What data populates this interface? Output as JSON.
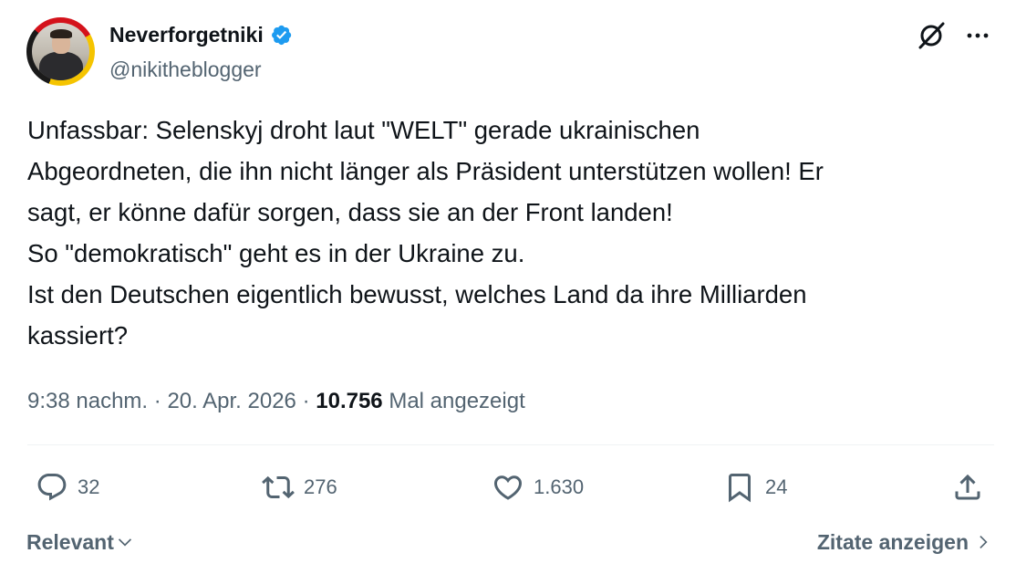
{
  "author": {
    "display_name": "Neverforgetniki",
    "handle": "@nikitheblogger",
    "verified": true,
    "verified_color": "#1d9bf0"
  },
  "tweet": {
    "text": "Unfassbar: Selenskyj droht laut \"WELT\" gerade ukrainischen\nAbgeordneten, die ihn nicht länger als Präsident unterstützen wollen! Er\nsagt, er könne dafür sorgen, dass sie an der Front landen!\nSo \"demokratisch\" geht es in der Ukraine zu.\nIst den Deutschen eigentlich bewusst, welches Land da ihre Milliarden\nkassiert?"
  },
  "meta": {
    "time": "9:38 nachm.",
    "separator": "·",
    "date": "20. Apr. 2026",
    "views_count": "10.756",
    "views_label": "Mal angezeigt"
  },
  "actions": {
    "replies": "32",
    "reposts": "276",
    "likes": "1.630",
    "bookmarks": "24"
  },
  "footer": {
    "sort_label": "Relevant",
    "quotes_label": "Zitate anzeigen"
  },
  "icons": {
    "header": [
      "grok-icon",
      "more-icon"
    ],
    "actions": [
      "reply-icon",
      "repost-icon",
      "like-icon",
      "bookmark-icon",
      "share-icon"
    ]
  },
  "colors": {
    "text_primary": "#0f1419",
    "text_secondary": "#536471",
    "divider": "#eff3f4"
  }
}
